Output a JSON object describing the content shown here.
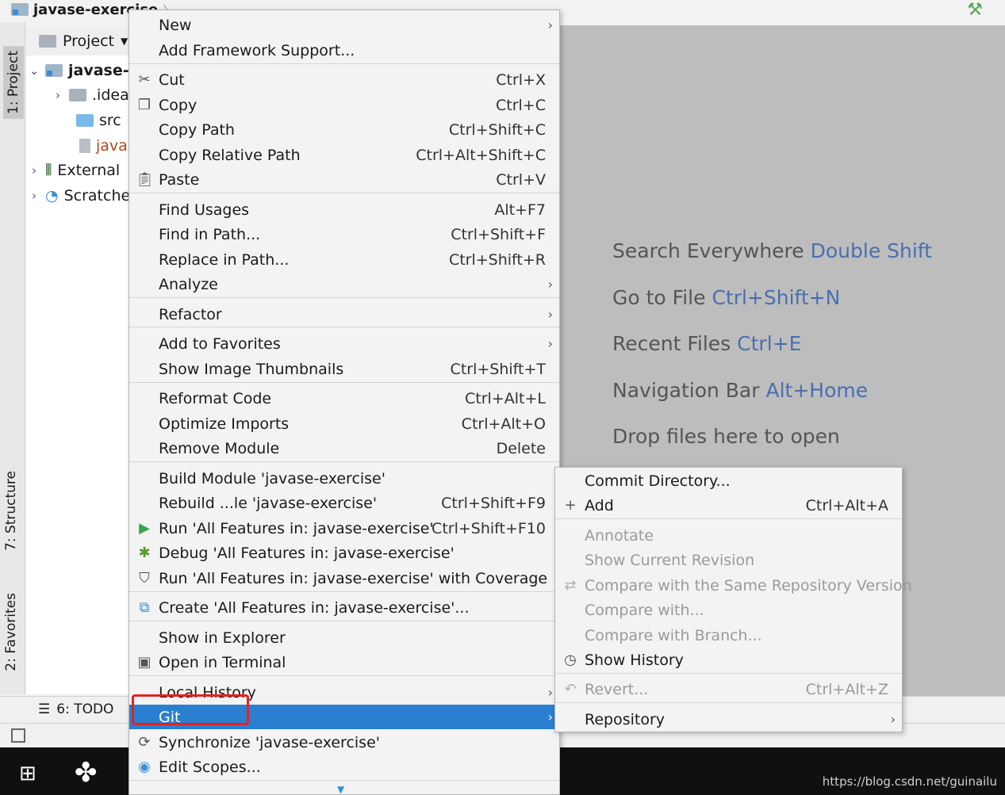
{
  "topbar": {
    "project_name": "javase-exercise",
    "crumb_chevron": "〉"
  },
  "left_strip": {
    "project_tab": "1: Project",
    "structure_tab": "7: Structure",
    "favorites_tab": "2: Favorites"
  },
  "project_panel": {
    "header": "Project",
    "tree": [
      {
        "label": "javase-e",
        "kind": "module",
        "expanded": true
      },
      {
        "label": ".idea",
        "kind": "folder"
      },
      {
        "label": "src",
        "kind": "src-folder"
      },
      {
        "label": "javas",
        "kind": "iml-file"
      },
      {
        "label": "External",
        "kind": "libraries"
      },
      {
        "label": "Scratche",
        "kind": "scratches"
      }
    ]
  },
  "main_menu": {
    "items": [
      {
        "label": "New",
        "shortcut": "",
        "submenu": true,
        "icon": ""
      },
      {
        "label": "Add Framework Support...",
        "shortcut": "",
        "submenu": false,
        "icon": ""
      },
      {
        "label": "Cut",
        "shortcut": "Ctrl+X",
        "submenu": false,
        "icon": "scissors-icon"
      },
      {
        "label": "Copy",
        "shortcut": "Ctrl+C",
        "submenu": false,
        "icon": "copy-icon"
      },
      {
        "label": "Copy Path",
        "shortcut": "Ctrl+Shift+C",
        "submenu": false,
        "icon": ""
      },
      {
        "label": "Copy Relative Path",
        "shortcut": "Ctrl+Alt+Shift+C",
        "submenu": false,
        "icon": ""
      },
      {
        "label": "Paste",
        "shortcut": "Ctrl+V",
        "submenu": false,
        "icon": "paste-icon"
      },
      {
        "label": "Find Usages",
        "shortcut": "Alt+F7",
        "submenu": false,
        "icon": ""
      },
      {
        "label": "Find in Path...",
        "shortcut": "Ctrl+Shift+F",
        "submenu": false,
        "icon": ""
      },
      {
        "label": "Replace in Path...",
        "shortcut": "Ctrl+Shift+R",
        "submenu": false,
        "icon": ""
      },
      {
        "label": "Analyze",
        "shortcut": "",
        "submenu": true,
        "icon": ""
      },
      {
        "label": "Refactor",
        "shortcut": "",
        "submenu": true,
        "icon": ""
      },
      {
        "label": "Add to Favorites",
        "shortcut": "",
        "submenu": true,
        "icon": ""
      },
      {
        "label": "Show Image Thumbnails",
        "shortcut": "Ctrl+Shift+T",
        "submenu": false,
        "icon": ""
      },
      {
        "label": "Reformat Code",
        "shortcut": "Ctrl+Alt+L",
        "submenu": false,
        "icon": ""
      },
      {
        "label": "Optimize Imports",
        "shortcut": "Ctrl+Alt+O",
        "submenu": false,
        "icon": ""
      },
      {
        "label": "Remove Module",
        "shortcut": "Delete",
        "submenu": false,
        "icon": ""
      },
      {
        "label": "Build Module 'javase-exercise'",
        "shortcut": "",
        "submenu": false,
        "icon": ""
      },
      {
        "label": "Rebuild ...le 'javase-exercise'",
        "shortcut": "Ctrl+Shift+F9",
        "submenu": false,
        "icon": ""
      },
      {
        "label": "Run 'All Features in: javase-exercise'",
        "shortcut": "Ctrl+Shift+F10",
        "submenu": false,
        "icon": "run-icon"
      },
      {
        "label": "Debug 'All Features in: javase-exercise'",
        "shortcut": "",
        "submenu": false,
        "icon": "debug-icon"
      },
      {
        "label": "Run 'All Features in: javase-exercise' with Coverage",
        "shortcut": "",
        "submenu": false,
        "icon": "coverage-icon"
      },
      {
        "label": "Create 'All Features in: javase-exercise'...",
        "shortcut": "",
        "submenu": false,
        "icon": "create-config-icon"
      },
      {
        "label": "Show in Explorer",
        "shortcut": "",
        "submenu": false,
        "icon": ""
      },
      {
        "label": "Open in Terminal",
        "shortcut": "",
        "submenu": false,
        "icon": "terminal-icon"
      },
      {
        "label": "Local History",
        "shortcut": "",
        "submenu": true,
        "icon": ""
      },
      {
        "label": "Git",
        "shortcut": "",
        "submenu": true,
        "icon": "",
        "selected": true
      },
      {
        "label": "Synchronize 'javase-exercise'",
        "shortcut": "",
        "submenu": false,
        "icon": "sync-icon"
      },
      {
        "label": "Edit Scopes...",
        "shortcut": "",
        "submenu": false,
        "icon": "scopes-icon"
      }
    ]
  },
  "git_submenu": {
    "items": [
      {
        "label": "Commit Directory...",
        "shortcut": "",
        "enabled": true,
        "submenu": false,
        "icon": ""
      },
      {
        "label": "Add",
        "shortcut": "Ctrl+Alt+A",
        "enabled": true,
        "submenu": false,
        "icon": "plus-icon"
      },
      {
        "label": "Annotate",
        "shortcut": "",
        "enabled": false,
        "submenu": false,
        "icon": ""
      },
      {
        "label": "Show Current Revision",
        "shortcut": "",
        "enabled": false,
        "submenu": false,
        "icon": ""
      },
      {
        "label": "Compare with the Same Repository Version",
        "shortcut": "",
        "enabled": false,
        "submenu": false,
        "icon": "compare-icon"
      },
      {
        "label": "Compare with...",
        "shortcut": "",
        "enabled": false,
        "submenu": false,
        "icon": ""
      },
      {
        "label": "Compare with Branch...",
        "shortcut": "",
        "enabled": false,
        "submenu": false,
        "icon": ""
      },
      {
        "label": "Show History",
        "shortcut": "",
        "enabled": true,
        "submenu": false,
        "icon": "clock-icon"
      },
      {
        "label": "Revert...",
        "shortcut": "Ctrl+Alt+Z",
        "enabled": false,
        "submenu": false,
        "icon": "revert-icon"
      },
      {
        "label": "Repository",
        "shortcut": "",
        "enabled": true,
        "submenu": true,
        "icon": ""
      }
    ]
  },
  "editor_hints": [
    {
      "text": "Search Everywhere ",
      "key": "Double Shift"
    },
    {
      "text": "Go to File ",
      "key": "Ctrl+Shift+N"
    },
    {
      "text": "Recent Files ",
      "key": "Ctrl+E"
    },
    {
      "text": "Navigation Bar ",
      "key": "Alt+Home"
    },
    {
      "text": "Drop files here to open",
      "key": ""
    }
  ],
  "bottom": {
    "todo_tab": "6: TODO"
  },
  "watermark": "https://blog.csdn.net/guinailu",
  "colors": {
    "selection": "#2a7fd0",
    "highlight_box": "#e8201e",
    "hint_key": "#4a6fb0",
    "editor_bg": "#bdbdbd"
  }
}
